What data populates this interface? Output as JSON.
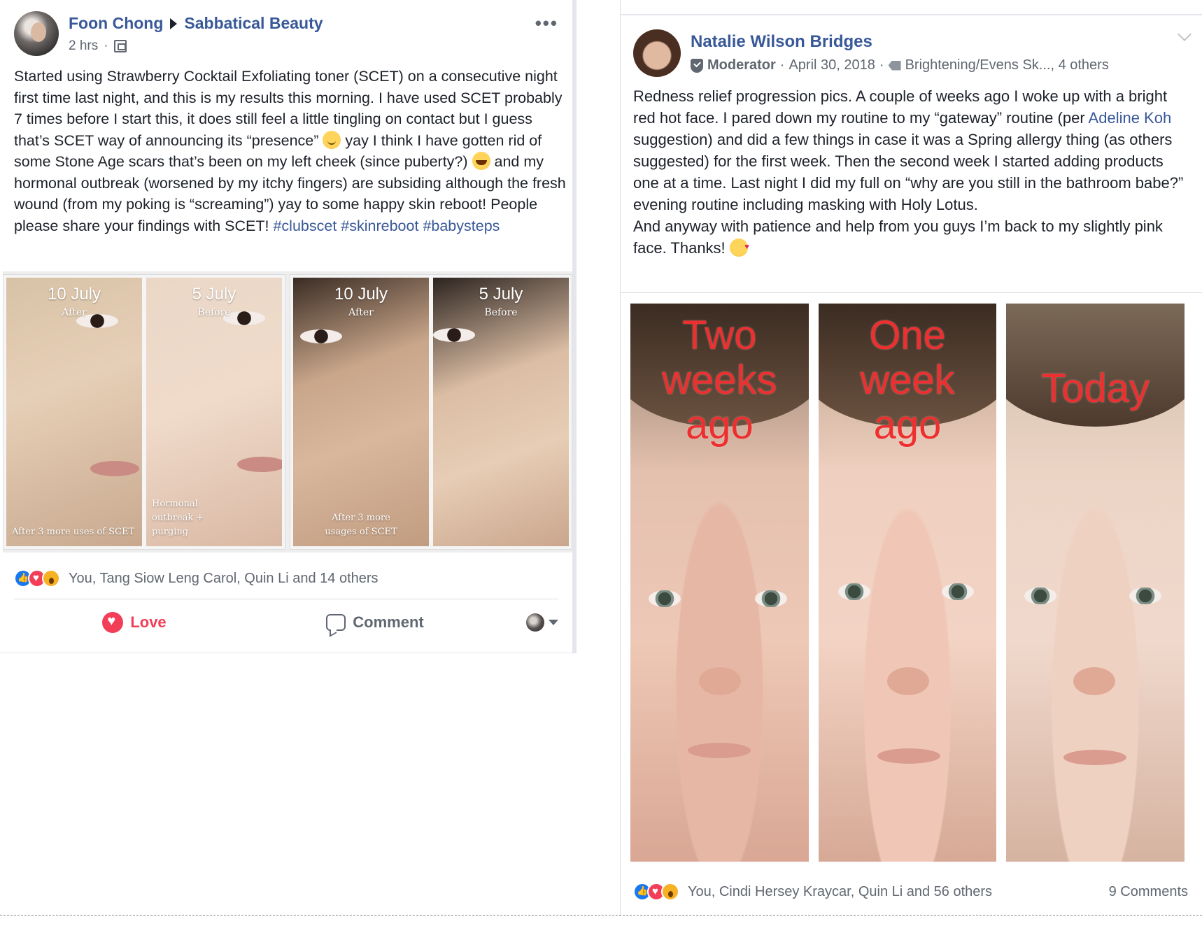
{
  "post1": {
    "author": "Foon Chong",
    "group": "Sabbatical Beauty",
    "time": "2 hrs",
    "more_icon": "more-dots-icon",
    "text_parts": {
      "p1": "Started using Strawberry Cocktail Exfoliating toner (SCET) on a consecutive night first time last night, and this is my results this morning. I have used SCET probably 7 times before I start this, it does still feel a little tingling on contact but I guess that’s SCET way of announcing its “presence” ",
      "p2": " yay I think I have gotten rid of some Stone Age scars that’s been on my left cheek (since puberty?) ",
      "p3": " and my hormonal outbreak (worsened by my itchy fingers) are subsiding although the fresh wound (from my poking is “screaming”) yay to some happy skin reboot! People please share your findings with SCET! ",
      "hashtags": [
        "#clubscet",
        "#skinreboot",
        "#babysteps"
      ]
    },
    "photos": [
      {
        "title": "10 July",
        "sub": "After",
        "note": "After 3 more uses of SCET"
      },
      {
        "title": "5 July",
        "sub": "Before",
        "note": "Hormonal\noutbreak +\npurging"
      },
      {
        "title": "10 July",
        "sub": "After",
        "note": "After 3 more\nusages of SCET"
      },
      {
        "title": "5 July",
        "sub": "Before",
        "note": ""
      }
    ],
    "reactions_text": "You, Tang Siow Leng Carol, Quin Li and 14 others",
    "actions": {
      "love": "Love",
      "comment": "Comment"
    }
  },
  "post2": {
    "author": "Natalie Wilson Bridges",
    "role": "Moderator",
    "date": "April 30, 2018",
    "topics": "Brightening/Evens Sk...",
    "topics_more": ", 4 others",
    "text_parts": {
      "a": "Redness relief progression pics. A couple of weeks ago I woke up with a bright red hot face. I pared down my routine to my “gateway” routine (per ",
      "mention": "Adeline Koh",
      "b": " suggestion) and did a few things in case it was a Spring allergy thing (as others suggested) for the first week. Then the second week I started adding products one at a time. Last night I did my full on “why are you still in the bathroom babe?” evening routine including masking with Holy Lotus.",
      "c": "And anyway with patience and help from you guys I’m back to my slightly pink face. Thanks! "
    },
    "photos": [
      {
        "label": "Two\nweeks\nago"
      },
      {
        "label": "One\nweek\nago"
      },
      {
        "label": "Today"
      }
    ],
    "reactions_text": "You, Cindi Hersey Kraycar, Quin Li and 56 others",
    "comments": "9 Comments"
  },
  "colors": {
    "link": "#385898",
    "love": "#f33e58",
    "like": "#1877f2",
    "overlay_red": "#ee2f2f"
  }
}
